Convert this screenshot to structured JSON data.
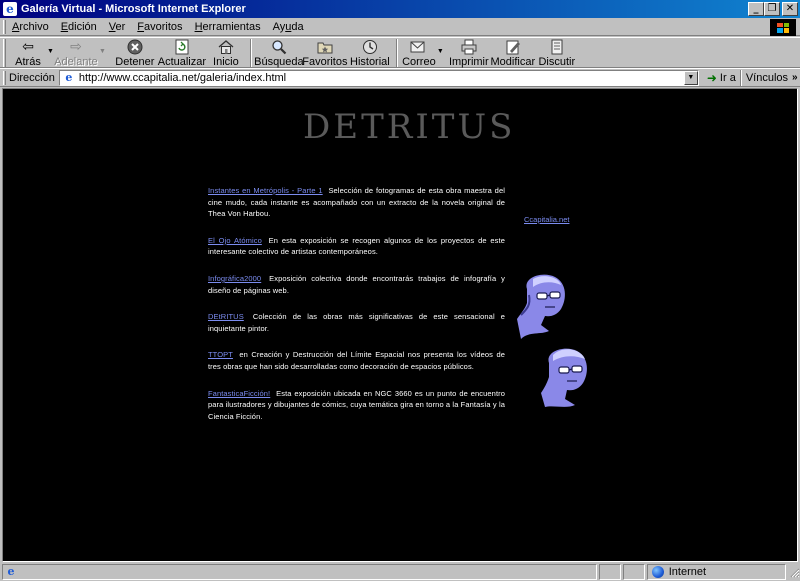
{
  "window": {
    "title": "Galería Virtual - Microsoft Internet Explorer",
    "app_icon": "ie-page-icon"
  },
  "menu": [
    {
      "pre": "",
      "ul": "A",
      "post": "rchivo"
    },
    {
      "pre": "",
      "ul": "E",
      "post": "dición"
    },
    {
      "pre": "",
      "ul": "V",
      "post": "er"
    },
    {
      "pre": "",
      "ul": "F",
      "post": "avoritos"
    },
    {
      "pre": "",
      "ul": "H",
      "post": "erramientas"
    },
    {
      "pre": "Ay",
      "ul": "u",
      "post": "da"
    }
  ],
  "toolbar": {
    "back": "Atrás",
    "forward": "Adelante",
    "stop": "Detener",
    "refresh": "Actualizar",
    "home": "Inicio",
    "search": "Búsqueda",
    "favorites": "Favoritos",
    "history": "Historial",
    "mail": "Correo",
    "print": "Imprimir",
    "edit": "Modificar",
    "discuss": "Discutir"
  },
  "address": {
    "label": "Dirección",
    "url": "http://www.ccapitalia.net/galeria/index.html",
    "go": "Ir a",
    "links": "Vínculos"
  },
  "page": {
    "logo_text": "DETRITUS",
    "side_link": "Ccapitalia.net",
    "entries": [
      {
        "link": "Instantes en Metrópolis - Parte 1",
        "text": "Selección de fotogramas de esta obra maestra del cine mudo, cada instante es acompañado con un extracto de la novela original de Thea Von Harbou."
      },
      {
        "link": "El Ojo Atómico",
        "text": "En esta exposición se recogen algunos de los proyectos de este interesante colectivo de artistas contemporáneos."
      },
      {
        "link": "Infográfica2000",
        "text": "Exposición colectiva donde encontrarás trabajos de infografía y diseño de páginas web."
      },
      {
        "link": "DEtRITUS",
        "text": "Colección de las obras más significativas de este sensacional e inquietante pintor."
      },
      {
        "link": "TTOPT",
        "text": "en Creación y Destrucción del Límite Espacial nos presenta los vídeos de tres obras que han sido desarrolladas como decoración de espacios públicos."
      },
      {
        "link": "FantasticaFicción!",
        "text": "Esta exposición ubicada en NGC 3660 es un punto de encuentro para ilustradores y dibujantes de cómics, cuya temática gira en torno a la Fantasía y la Ciencia Ficción."
      }
    ]
  },
  "status": {
    "text": "",
    "zone": "Internet"
  },
  "colors": {
    "link": "#7b8cf0",
    "page_bg": "#000000",
    "chrome": "#c0c0c0",
    "titlebar": "#000080"
  }
}
